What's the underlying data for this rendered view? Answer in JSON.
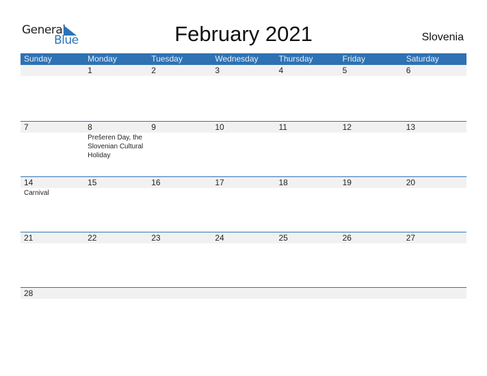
{
  "logo": {
    "line1": "General",
    "line2": "Blue",
    "icon": "triangle-flag-icon",
    "accent": "#2b73b9"
  },
  "title": "February 2021",
  "country": "Slovenia",
  "colors": {
    "header_bg": "#2e72b4",
    "date_strip_bg": "#f1f1f1",
    "divider": "#2e72b4"
  },
  "weekdays": [
    "Sunday",
    "Monday",
    "Tuesday",
    "Wednesday",
    "Thursday",
    "Friday",
    "Saturday"
  ],
  "weeks": [
    {
      "dates": [
        "",
        "1",
        "2",
        "3",
        "4",
        "5",
        "6"
      ],
      "events": [
        "",
        "",
        "",
        "",
        "",
        "",
        ""
      ]
    },
    {
      "dates": [
        "7",
        "8",
        "9",
        "10",
        "11",
        "12",
        "13"
      ],
      "events": [
        "",
        "Prešeren Day, the Slovenian Cultural Holiday",
        "",
        "",
        "",
        "",
        ""
      ]
    },
    {
      "dates": [
        "14",
        "15",
        "16",
        "17",
        "18",
        "19",
        "20"
      ],
      "events": [
        "Carnival",
        "",
        "",
        "",
        "",
        "",
        ""
      ]
    },
    {
      "dates": [
        "21",
        "22",
        "23",
        "24",
        "25",
        "26",
        "27"
      ],
      "events": [
        "",
        "",
        "",
        "",
        "",
        "",
        ""
      ]
    },
    {
      "dates": [
        "28",
        "",
        "",
        "",
        "",
        "",
        ""
      ],
      "events": [
        "",
        "",
        "",
        "",
        "",
        "",
        ""
      ]
    }
  ]
}
